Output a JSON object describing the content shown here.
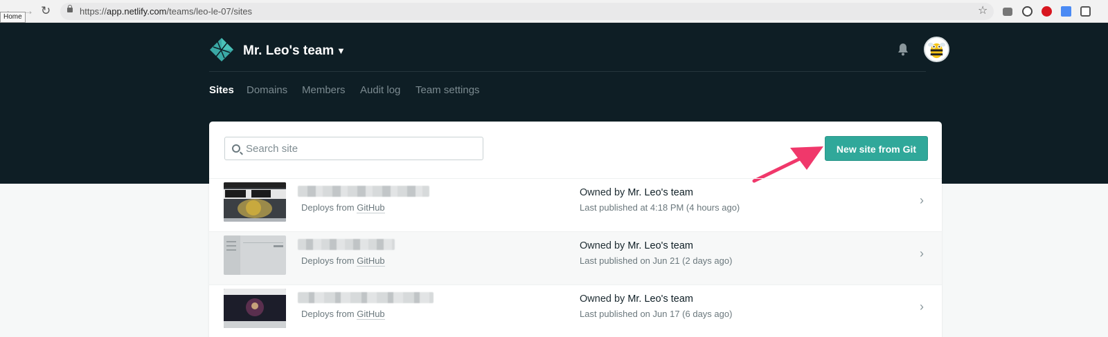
{
  "browser": {
    "url_prefix": "https://",
    "url_host": "app.netlify.com",
    "url_path": "/teams/leo-le-07/sites",
    "tooltip": "Home"
  },
  "header": {
    "team_name": "Mr. Leo's team",
    "tabs": [
      {
        "label": "Sites",
        "active": true
      },
      {
        "label": "Domains",
        "active": false
      },
      {
        "label": "Members",
        "active": false
      },
      {
        "label": "Audit log",
        "active": false
      },
      {
        "label": "Team settings",
        "active": false
      }
    ]
  },
  "toolbar": {
    "search_placeholder": "Search site",
    "new_site_label": "New site from Git"
  },
  "sites": [
    {
      "deploys_prefix": "Deploys from ",
      "deploys_source": "GitHub",
      "owned_prefix": "Owned by ",
      "owner": "Mr. Leo's team",
      "published": "Last published at 4:18 PM (4 hours ago)"
    },
    {
      "deploys_prefix": "Deploys from ",
      "deploys_source": "GitHub",
      "owned_prefix": "Owned by ",
      "owner": "Mr. Leo's team",
      "published": "Last published on Jun 21 (2 days ago)"
    },
    {
      "deploys_prefix": "Deploys from ",
      "deploys_source": "GitHub",
      "owned_prefix": "Owned by ",
      "owner": "Mr. Leo's team",
      "published": "Last published on Jun 17 (6 days ago)"
    }
  ],
  "colors": {
    "header_bg": "#0e1e25",
    "accent": "#30a89a",
    "arrow": "#f0386b"
  }
}
